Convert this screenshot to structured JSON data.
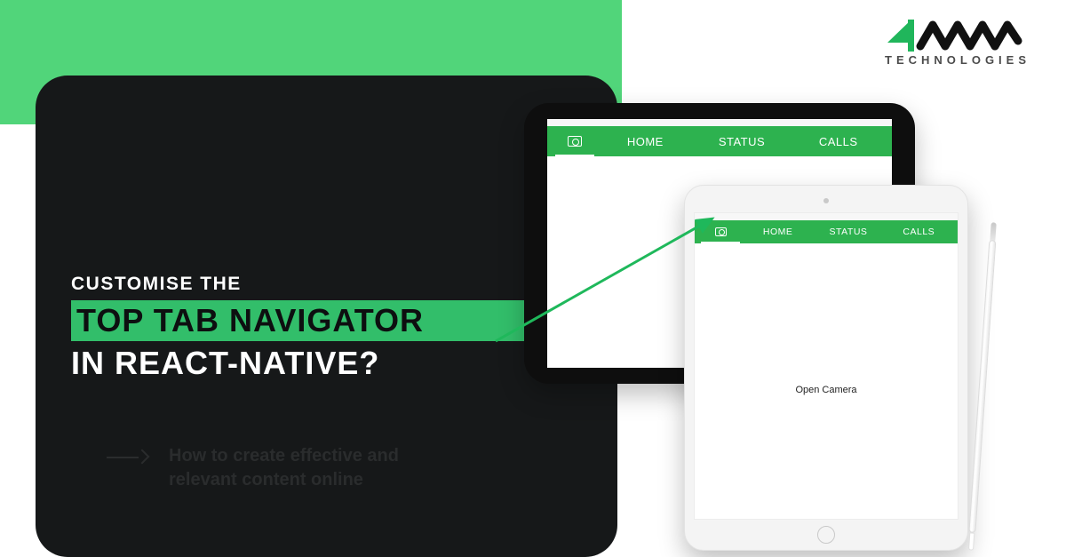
{
  "branding": {
    "logo_sub": "TECHNOLOGIES"
  },
  "headline": {
    "line1": "CUSTOMISE THE",
    "line2": "TOP TAB NAVIGATOR",
    "line3": "IN REACT-NATIVE?"
  },
  "subtext": "How to create effective and relevant content online",
  "tabs": {
    "camera_icon": "camera",
    "home": "HOME",
    "status": "STATUS",
    "calls": "CALLS"
  },
  "tablet_light": {
    "center_text": "Open Camera"
  },
  "colors": {
    "accent": "#51d57a",
    "tabbar": "#2db24f",
    "highlight": "#32be6a",
    "dark": "#161819"
  }
}
